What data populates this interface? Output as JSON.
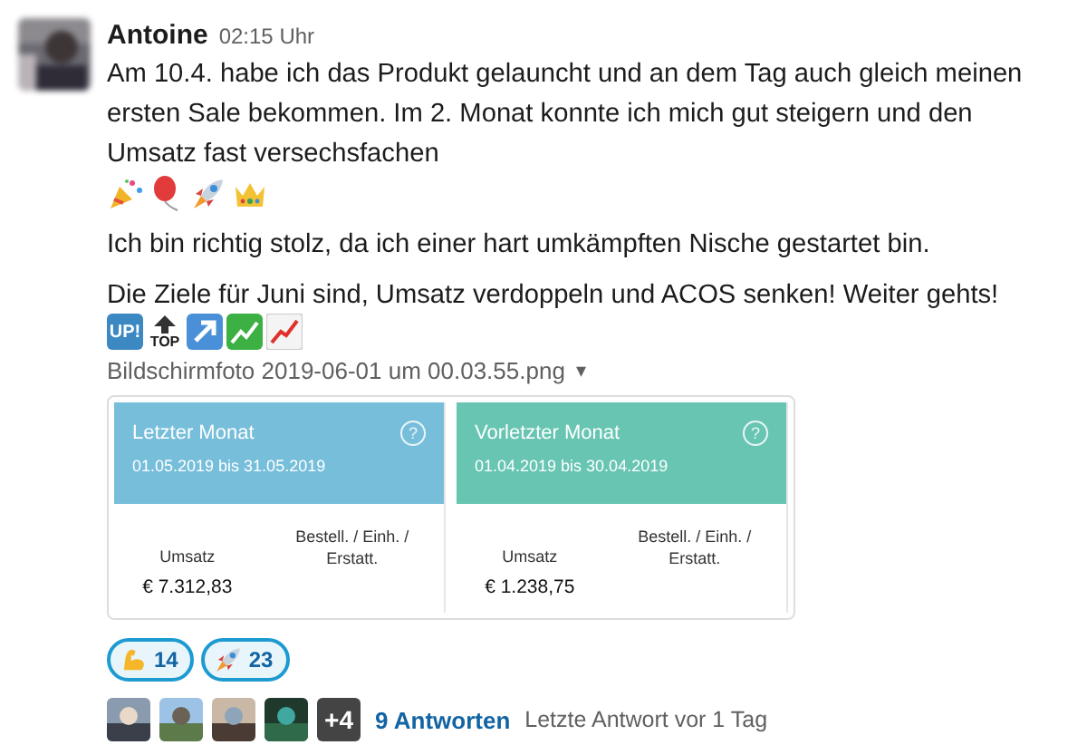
{
  "message": {
    "author": "Antoine",
    "time": "02:15 Uhr",
    "paragraphs": [
      {
        "text": "Am 10.4. habe ich das Produkt gelauncht und an dem Tag auch gleich meinen ersten Sale bekommen. Im 2. Monat konnte ich mich gut steigern und den Umsatz fast versechsfachen",
        "emojis": [
          {
            "kind": "party"
          },
          {
            "kind": "balloon"
          },
          {
            "kind": "rocket"
          },
          {
            "kind": "crown"
          }
        ]
      },
      {
        "text": "Ich bin richtig stolz, da ich einer hart umkämpften Nische gestartet bin."
      },
      {
        "text": "Die Ziele für Juni sind, Umsatz verdoppeln und ACOS senken! Weiter gehts!"
      }
    ],
    "goal_emojis": [
      {
        "kind": "up",
        "label": "UP!"
      },
      {
        "kind": "top",
        "label": "TOP"
      },
      {
        "kind": "arrow"
      },
      {
        "kind": "money_chart"
      },
      {
        "kind": "chart"
      }
    ]
  },
  "attachment": {
    "filename": "Bildschirmfoto 2019-06-01 um 00.03.55.png",
    "caret": "▾",
    "panels": [
      {
        "title": "Letzter Monat",
        "range": "01.05.2019 bis 31.05.2019",
        "color": "#77bedb",
        "help": "?",
        "col_1": "Umsatz",
        "col_2": "Bestell. / Einh. / Erstatt.",
        "value": "€ 7.312,83"
      },
      {
        "title": "Vorletzter Monat",
        "range": "01.04.2019 bis 30.04.2019",
        "color": "#67c5b2",
        "help": "?",
        "col_1": "Umsatz",
        "col_2": "Bestell. / Einh. / Erstatt.",
        "value": "€ 1.238,75"
      }
    ]
  },
  "reactions": [
    {
      "kind": "muscle",
      "count": "14",
      "selected": true
    },
    {
      "kind": "rocket",
      "count": "23",
      "selected": true
    }
  ],
  "thread": {
    "avatars": [
      {
        "kind": "picture"
      },
      {
        "kind": "picture"
      },
      {
        "kind": "picture"
      },
      {
        "kind": "picture"
      },
      {
        "kind": "more",
        "label": "+4"
      }
    ],
    "replies": "9 Antworten",
    "last_reply": "Letzte Antwort vor 1 Tag"
  }
}
